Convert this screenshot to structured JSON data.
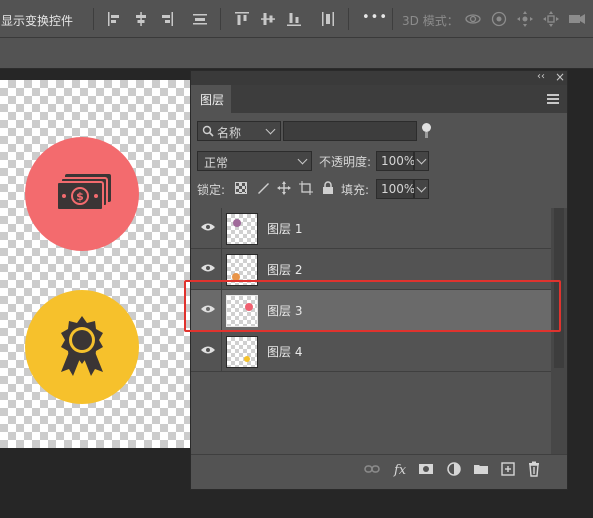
{
  "options_bar": {
    "show_transform_controls": "显示变换控件",
    "mode_3d_label": "3D 模式：",
    "more_label": "•••"
  },
  "layers_panel": {
    "collapse_label": "‹‹",
    "close_label": "×",
    "tab_label": "图层",
    "filter_kind": "名称",
    "blend_mode": "正常",
    "opacity_label": "不透明度:",
    "opacity_value": "100%",
    "lock_label": "锁定:",
    "fill_label": "填充:",
    "fill_value": "100%",
    "layers": [
      {
        "name": "图层 1",
        "selected": false,
        "thumb_color": "#a06a9a"
      },
      {
        "name": "图层 2",
        "selected": false,
        "thumb_color": "#e8954a"
      },
      {
        "name": "图层 3",
        "selected": true,
        "thumb_color": "#f06070"
      },
      {
        "name": "图层 4",
        "selected": false,
        "thumb_color": "#f5c22a"
      }
    ]
  },
  "canvas": {
    "colors": {
      "red_circle": "#f36b6e",
      "yellow_circle": "#f6c12c",
      "icon_dark": "#3b3535"
    }
  }
}
